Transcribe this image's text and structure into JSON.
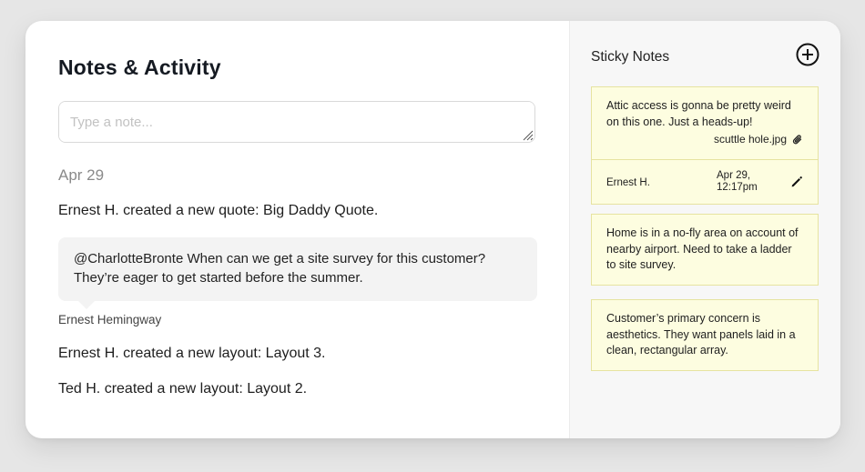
{
  "header": {
    "title": "Notes & Activity"
  },
  "note_input": {
    "placeholder": "Type a note..."
  },
  "activity": {
    "date": "Apr 29",
    "items": [
      "Ernest H. created a new quote: Big Daddy Quote.",
      "Ernest H. created a new layout: Layout 3.",
      "Ted H. created a new layout: Layout 2."
    ],
    "comment": {
      "line1": "@CharlotteBronte When can we get a site survey for this customer?",
      "line2": "They’re eager to get started before the summer.",
      "author": "Ernest Hemingway"
    }
  },
  "sidebar": {
    "title": "Sticky Notes",
    "add_icon": "plus-circle-icon",
    "notes": [
      {
        "lines": [
          "Attic access is gonna be pretty weird",
          "on this one. Just a heads-up!"
        ],
        "attachment": "scuttle hole.jpg",
        "author": "Ernest H.",
        "date_line1": "Apr 29,",
        "date_line2": "12:17pm"
      },
      {
        "lines": [
          "Home is in a no-fly area on account of",
          "nearby airport. Need to take a ladder",
          "to site survey."
        ]
      },
      {
        "lines": [
          "Customer’s primary concern is",
          "aesthetics. They want panels laid in a",
          "clean, rectangular array."
        ]
      }
    ]
  },
  "colors": {
    "page_bg": "#e6e6e6",
    "card_bg": "#ffffff",
    "sidebar_bg": "#f7f7f7",
    "sticky_bg": "#fdfde0",
    "sticky_border": "#e6e3a0",
    "comment_bg": "#f3f3f3"
  }
}
